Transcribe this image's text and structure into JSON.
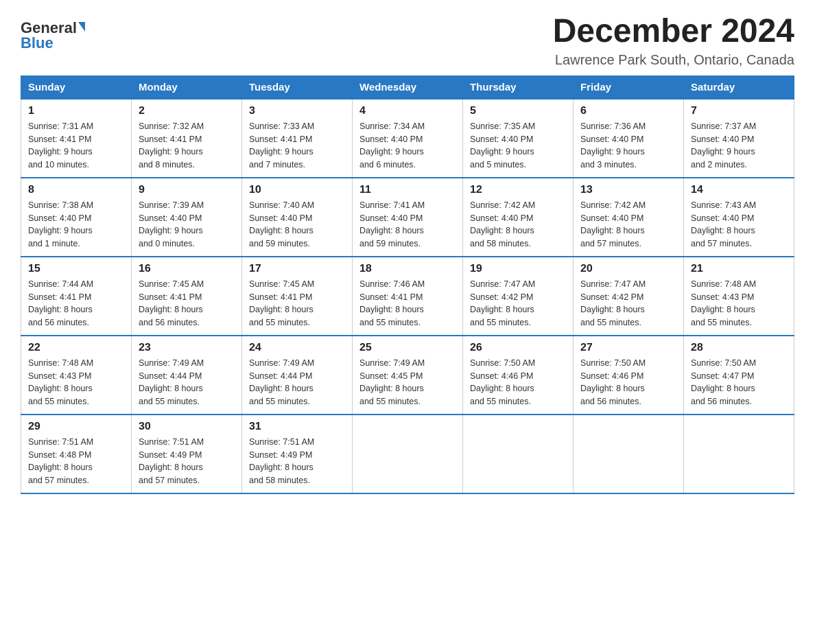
{
  "header": {
    "logo": {
      "general": "General",
      "blue": "Blue",
      "alt": "GeneralBlue logo"
    },
    "title": "December 2024",
    "location": "Lawrence Park South, Ontario, Canada"
  },
  "days_of_week": [
    "Sunday",
    "Monday",
    "Tuesday",
    "Wednesday",
    "Thursday",
    "Friday",
    "Saturday"
  ],
  "weeks": [
    [
      {
        "day": "1",
        "sunrise": "7:31 AM",
        "sunset": "4:41 PM",
        "daylight": "9 hours and 10 minutes."
      },
      {
        "day": "2",
        "sunrise": "7:32 AM",
        "sunset": "4:41 PM",
        "daylight": "9 hours and 8 minutes."
      },
      {
        "day": "3",
        "sunrise": "7:33 AM",
        "sunset": "4:41 PM",
        "daylight": "9 hours and 7 minutes."
      },
      {
        "day": "4",
        "sunrise": "7:34 AM",
        "sunset": "4:40 PM",
        "daylight": "9 hours and 6 minutes."
      },
      {
        "day": "5",
        "sunrise": "7:35 AM",
        "sunset": "4:40 PM",
        "daylight": "9 hours and 5 minutes."
      },
      {
        "day": "6",
        "sunrise": "7:36 AM",
        "sunset": "4:40 PM",
        "daylight": "9 hours and 3 minutes."
      },
      {
        "day": "7",
        "sunrise": "7:37 AM",
        "sunset": "4:40 PM",
        "daylight": "9 hours and 2 minutes."
      }
    ],
    [
      {
        "day": "8",
        "sunrise": "7:38 AM",
        "sunset": "4:40 PM",
        "daylight": "9 hours and 1 minute."
      },
      {
        "day": "9",
        "sunrise": "7:39 AM",
        "sunset": "4:40 PM",
        "daylight": "9 hours and 0 minutes."
      },
      {
        "day": "10",
        "sunrise": "7:40 AM",
        "sunset": "4:40 PM",
        "daylight": "8 hours and 59 minutes."
      },
      {
        "day": "11",
        "sunrise": "7:41 AM",
        "sunset": "4:40 PM",
        "daylight": "8 hours and 59 minutes."
      },
      {
        "day": "12",
        "sunrise": "7:42 AM",
        "sunset": "4:40 PM",
        "daylight": "8 hours and 58 minutes."
      },
      {
        "day": "13",
        "sunrise": "7:42 AM",
        "sunset": "4:40 PM",
        "daylight": "8 hours and 57 minutes."
      },
      {
        "day": "14",
        "sunrise": "7:43 AM",
        "sunset": "4:40 PM",
        "daylight": "8 hours and 57 minutes."
      }
    ],
    [
      {
        "day": "15",
        "sunrise": "7:44 AM",
        "sunset": "4:41 PM",
        "daylight": "8 hours and 56 minutes."
      },
      {
        "day": "16",
        "sunrise": "7:45 AM",
        "sunset": "4:41 PM",
        "daylight": "8 hours and 56 minutes."
      },
      {
        "day": "17",
        "sunrise": "7:45 AM",
        "sunset": "4:41 PM",
        "daylight": "8 hours and 55 minutes."
      },
      {
        "day": "18",
        "sunrise": "7:46 AM",
        "sunset": "4:41 PM",
        "daylight": "8 hours and 55 minutes."
      },
      {
        "day": "19",
        "sunrise": "7:47 AM",
        "sunset": "4:42 PM",
        "daylight": "8 hours and 55 minutes."
      },
      {
        "day": "20",
        "sunrise": "7:47 AM",
        "sunset": "4:42 PM",
        "daylight": "8 hours and 55 minutes."
      },
      {
        "day": "21",
        "sunrise": "7:48 AM",
        "sunset": "4:43 PM",
        "daylight": "8 hours and 55 minutes."
      }
    ],
    [
      {
        "day": "22",
        "sunrise": "7:48 AM",
        "sunset": "4:43 PM",
        "daylight": "8 hours and 55 minutes."
      },
      {
        "day": "23",
        "sunrise": "7:49 AM",
        "sunset": "4:44 PM",
        "daylight": "8 hours and 55 minutes."
      },
      {
        "day": "24",
        "sunrise": "7:49 AM",
        "sunset": "4:44 PM",
        "daylight": "8 hours and 55 minutes."
      },
      {
        "day": "25",
        "sunrise": "7:49 AM",
        "sunset": "4:45 PM",
        "daylight": "8 hours and 55 minutes."
      },
      {
        "day": "26",
        "sunrise": "7:50 AM",
        "sunset": "4:46 PM",
        "daylight": "8 hours and 55 minutes."
      },
      {
        "day": "27",
        "sunrise": "7:50 AM",
        "sunset": "4:46 PM",
        "daylight": "8 hours and 56 minutes."
      },
      {
        "day": "28",
        "sunrise": "7:50 AM",
        "sunset": "4:47 PM",
        "daylight": "8 hours and 56 minutes."
      }
    ],
    [
      {
        "day": "29",
        "sunrise": "7:51 AM",
        "sunset": "4:48 PM",
        "daylight": "8 hours and 57 minutes."
      },
      {
        "day": "30",
        "sunrise": "7:51 AM",
        "sunset": "4:49 PM",
        "daylight": "8 hours and 57 minutes."
      },
      {
        "day": "31",
        "sunrise": "7:51 AM",
        "sunset": "4:49 PM",
        "daylight": "8 hours and 58 minutes."
      },
      null,
      null,
      null,
      null
    ]
  ],
  "labels": {
    "sunrise": "Sunrise:",
    "sunset": "Sunset:",
    "daylight": "Daylight:"
  }
}
